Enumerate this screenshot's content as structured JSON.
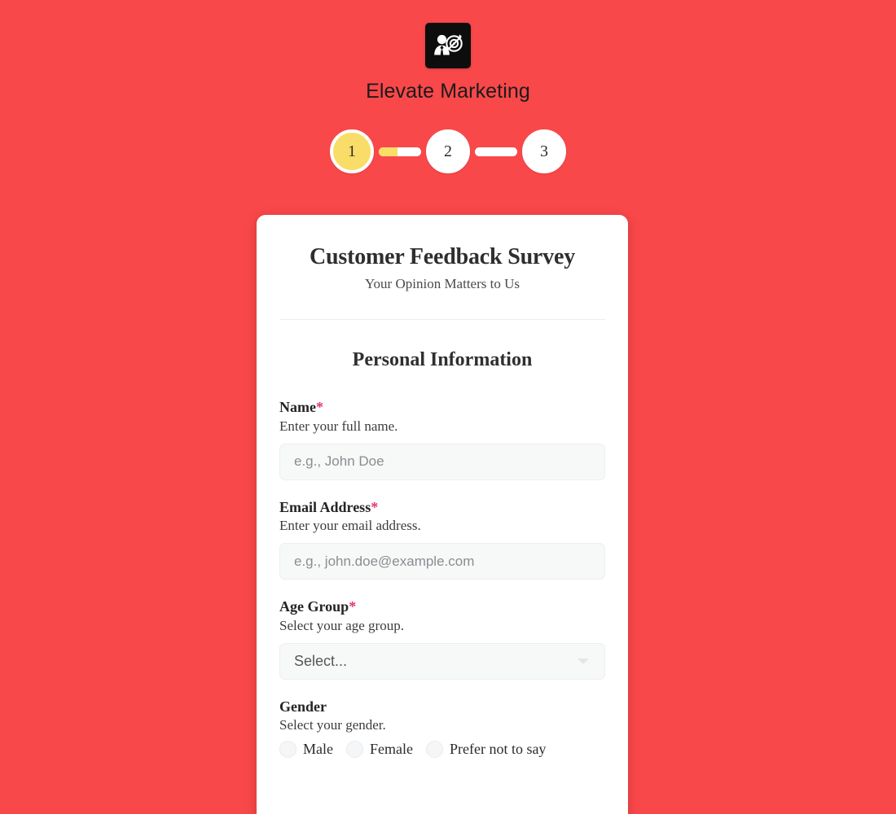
{
  "brand": {
    "name": "Elevate Marketing",
    "logo_icon": "marketer-target-icon",
    "logo_bg": "#0d0d0d"
  },
  "theme": {
    "background": "#f9484a",
    "accent_yellow": "#f9dd68",
    "required_marker": "#e5336c",
    "card_background": "#ffffff"
  },
  "stepper": {
    "current_step": 1,
    "steps": [
      {
        "label": "1",
        "state": "active"
      },
      {
        "label": "2",
        "state": "upcoming"
      },
      {
        "label": "3",
        "state": "upcoming"
      }
    ],
    "connectors": [
      {
        "progress_percent": 45
      },
      {
        "progress_percent": 0
      }
    ]
  },
  "form": {
    "title": "Customer Feedback Survey",
    "subtitle": "Your Opinion Matters to Us",
    "section_title": "Personal Information",
    "fields": [
      {
        "label": "Name",
        "required": true,
        "required_marker": "*",
        "help": "Enter your full name.",
        "type": "text",
        "value": "",
        "placeholder": "e.g., John Doe"
      },
      {
        "label": "Email Address",
        "required": true,
        "required_marker": "*",
        "help": "Enter your email address.",
        "type": "email",
        "value": "",
        "placeholder": "e.g., john.doe@example.com"
      },
      {
        "label": "Age Group",
        "required": true,
        "required_marker": "*",
        "help": "Select your age group.",
        "type": "select",
        "selected": "Select...",
        "caret_icon": "chevron-down-icon"
      },
      {
        "label": "Gender",
        "required": false,
        "required_marker": "",
        "help": "Select your gender.",
        "type": "radio",
        "options": [
          {
            "label": "Male",
            "checked": false
          },
          {
            "label": "Female",
            "checked": false
          },
          {
            "label": "Prefer not to say",
            "checked": false
          }
        ]
      }
    ]
  }
}
